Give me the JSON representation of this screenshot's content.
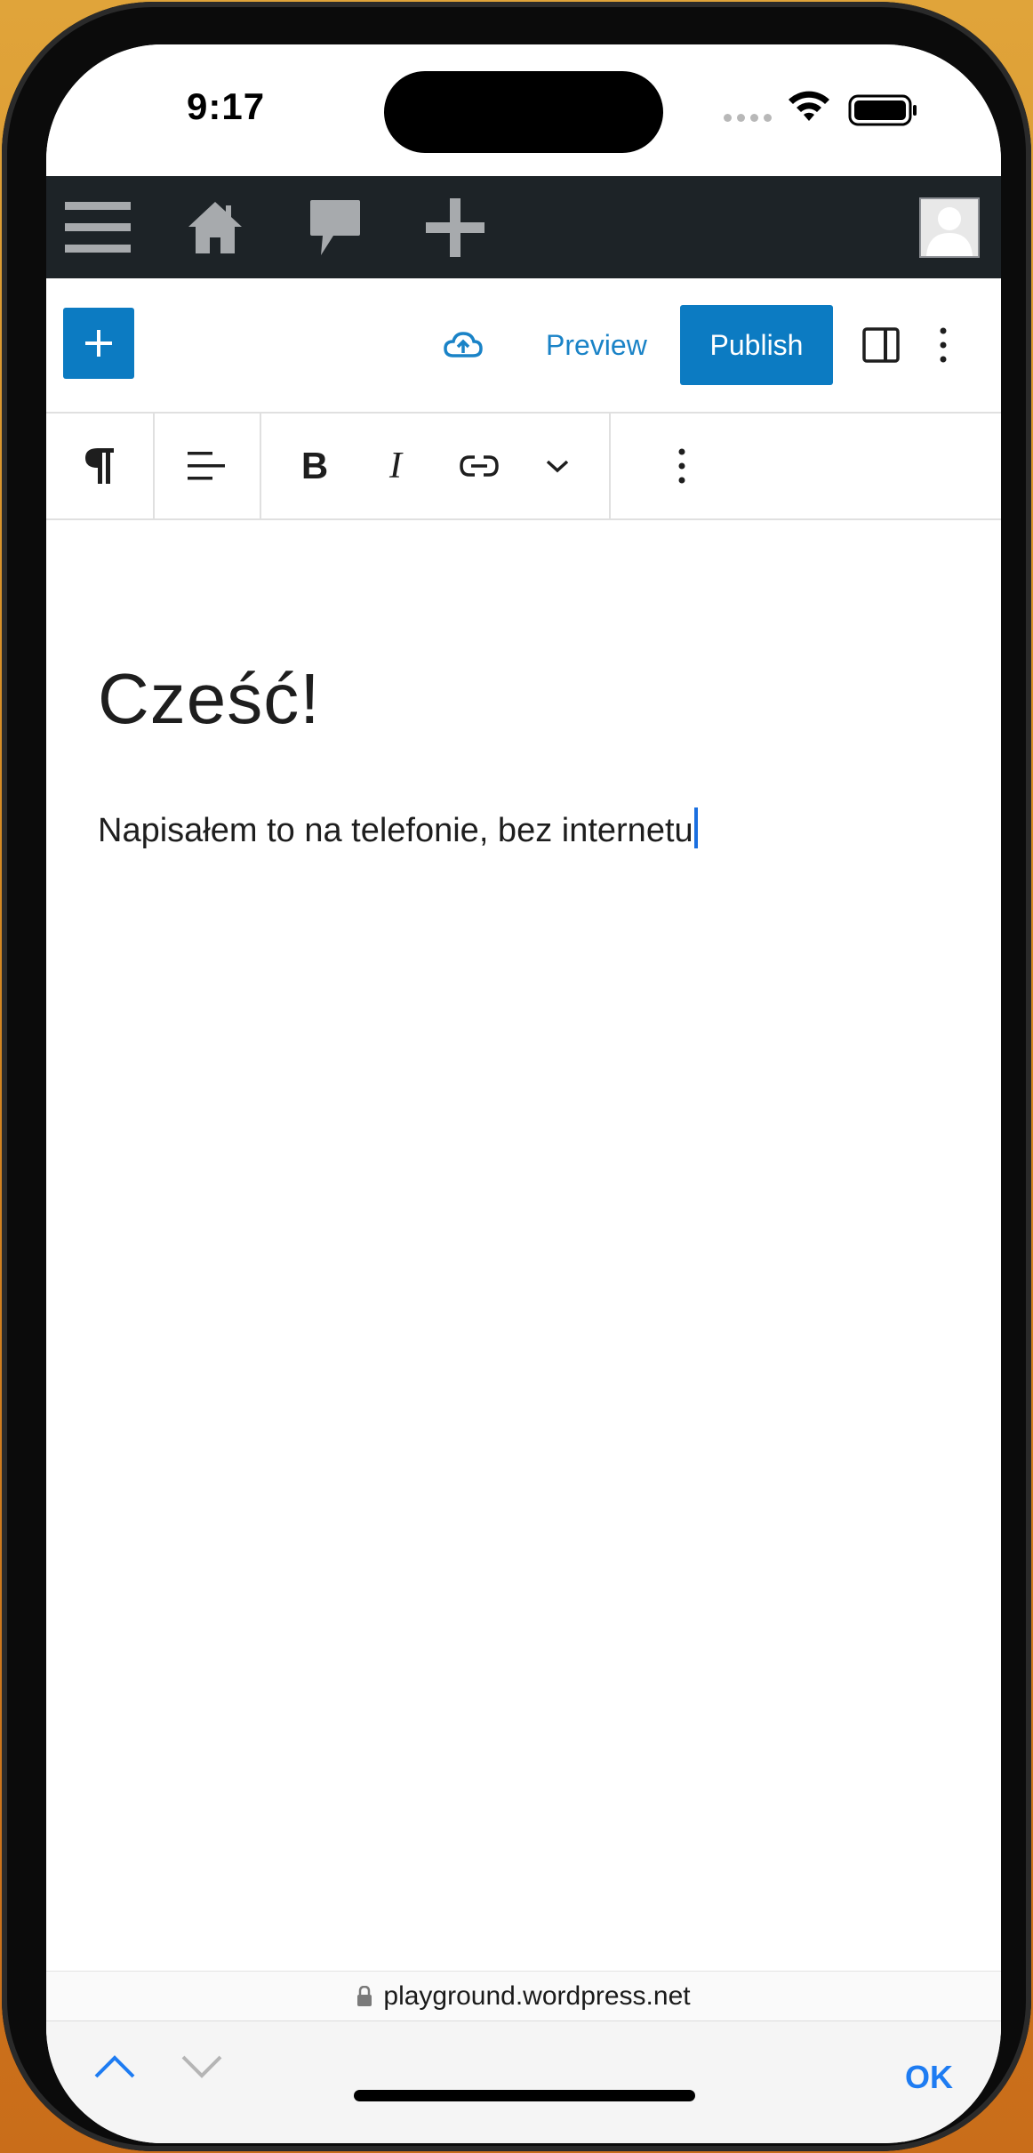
{
  "status_bar": {
    "time": "9:17"
  },
  "admin_bar": {
    "icons": [
      "menu-icon",
      "home-icon",
      "comment-icon",
      "plus-icon",
      "avatar-icon"
    ]
  },
  "editor_header": {
    "inserter_icon": "plus-icon",
    "save_icon": "cloud-upload-icon",
    "preview_label": "Preview",
    "publish_label": "Publish",
    "accent_color": "#0c7bc2"
  },
  "block_toolbar": {
    "items": [
      "pilcrow-icon",
      "align-icon",
      "bold-icon",
      "italic-icon",
      "link-icon",
      "chevron-down-icon",
      "more-options-icon"
    ],
    "bold_glyph": "B",
    "italic_glyph": "I"
  },
  "content": {
    "title": "Cześć!",
    "paragraph": "Napisałem to na telefonie, bez internetu"
  },
  "browser": {
    "url": "playground.wordpress.net"
  },
  "accessory_bar": {
    "ok_label": "OK"
  }
}
